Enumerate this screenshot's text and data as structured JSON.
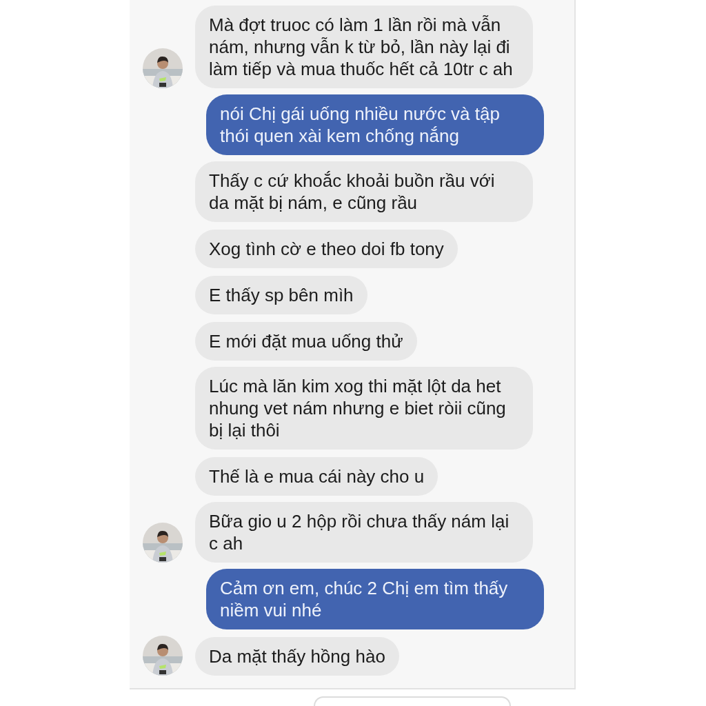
{
  "messages": [
    {
      "kind": "received",
      "avatar": true,
      "text": "Mà đợt truoc có làm 1 lần rồi mà vẫn nám, nhưng vẫn k từ bỏ, lần này lại đi làm tiếp và mua thuốc hết cả 10tr c ah"
    },
    {
      "kind": "sent",
      "avatar": false,
      "text": "nói Chị gái uống nhiều nước và tập thói quen xài kem chống nắng"
    },
    {
      "kind": "received",
      "avatar": false,
      "text": "Thấy c cứ khoắc khoải buồn rầu với da mặt bị nám, e cũng rầu"
    },
    {
      "kind": "received",
      "avatar": false,
      "text": "Xog tình cờ e theo doi fb tony"
    },
    {
      "kind": "received",
      "avatar": false,
      "text": "E thấy sp bên mìh"
    },
    {
      "kind": "received",
      "avatar": false,
      "text": "E mới đặt mua uống thử"
    },
    {
      "kind": "received",
      "avatar": false,
      "text": "Lúc mà lăn kim xog thi mặt lột da het nhung vet nám nhưng e biet ròii cũng bị lại thôi"
    },
    {
      "kind": "received",
      "avatar": false,
      "text": "Thế là e mua cái này cho u"
    },
    {
      "kind": "received",
      "avatar": true,
      "text": "Bữa gio u 2 hộp rồi chưa thấy nám lại c ah"
    },
    {
      "kind": "sent",
      "avatar": false,
      "text": "Cảm ơn em, chúc 2 Chị em tìm thấy niềm vui nhé"
    },
    {
      "kind": "received",
      "avatar": true,
      "text": "Da mặt thấy hồng hào"
    }
  ]
}
